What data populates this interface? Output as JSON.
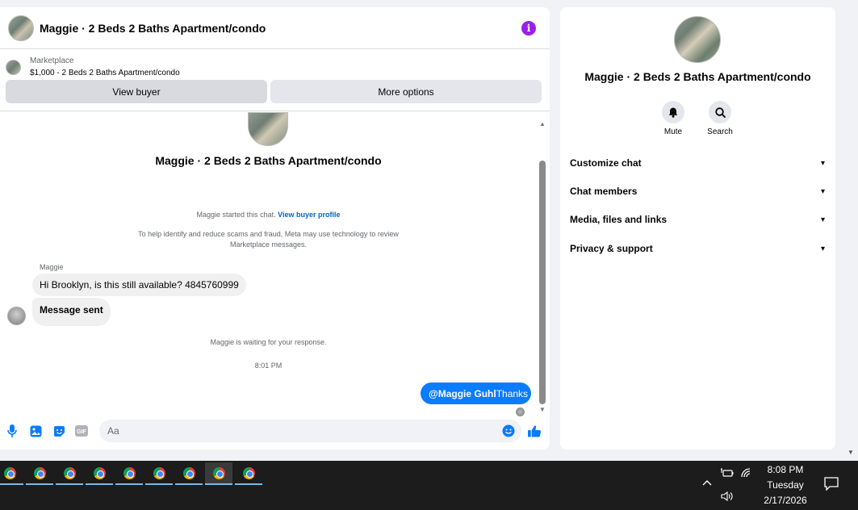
{
  "header": {
    "title": "Maggie · 2 Beds 2 Baths Apartment/condo",
    "info_icon": "info-icon",
    "info_glyph": "i",
    "accent_color": "#9b1fe8"
  },
  "marketplace": {
    "label": "Marketplace",
    "listing": "$1,000 - 2 Beds 2 Baths Apartment/condo"
  },
  "actions": {
    "view_buyer": "View buyer",
    "more_options": "More options"
  },
  "conversation": {
    "title": "Maggie · 2 Beds 2 Baths Apartment/condo",
    "started_text": "Maggie started this chat.",
    "view_profile_link": "View buyer profile",
    "notice_line1": "To help identify and reduce scams and fraud, Meta may use technology to review",
    "notice_line2": "Marketplace messages.",
    "sender_name": "Maggie",
    "messages": [
      {
        "text": "Hi Brooklyn, is this still available? 4845760999"
      },
      {
        "text": "Message sent"
      }
    ],
    "waiting_text": "Maggie is waiting for your response.",
    "time": "8:01 PM",
    "outgoing_mention": "@Maggie Guhl",
    "outgoing_text": "Thanks",
    "outgoing_color": "#0a7cff"
  },
  "composer": {
    "placeholder": "Aa",
    "icon_color": "#0a7cff",
    "gif_label": "GIF"
  },
  "details": {
    "title": "Maggie · 2 Beds 2 Baths Apartment/condo",
    "mute_label": "Mute",
    "search_label": "Search",
    "sections": [
      {
        "label": "Customize chat"
      },
      {
        "label": "Chat members"
      },
      {
        "label": "Media, files and links"
      },
      {
        "label": "Privacy & support"
      }
    ]
  },
  "taskbar": {
    "apps": [
      "chrome-icon",
      "chrome-icon",
      "chrome-icon",
      "chrome-icon",
      "chrome-icon",
      "chrome-icon",
      "chrome-icon",
      "chrome-icon",
      "chrome-icon"
    ],
    "active_index": 7,
    "time": "8:08 PM",
    "day": "Tuesday",
    "date": "2/17/2026"
  }
}
